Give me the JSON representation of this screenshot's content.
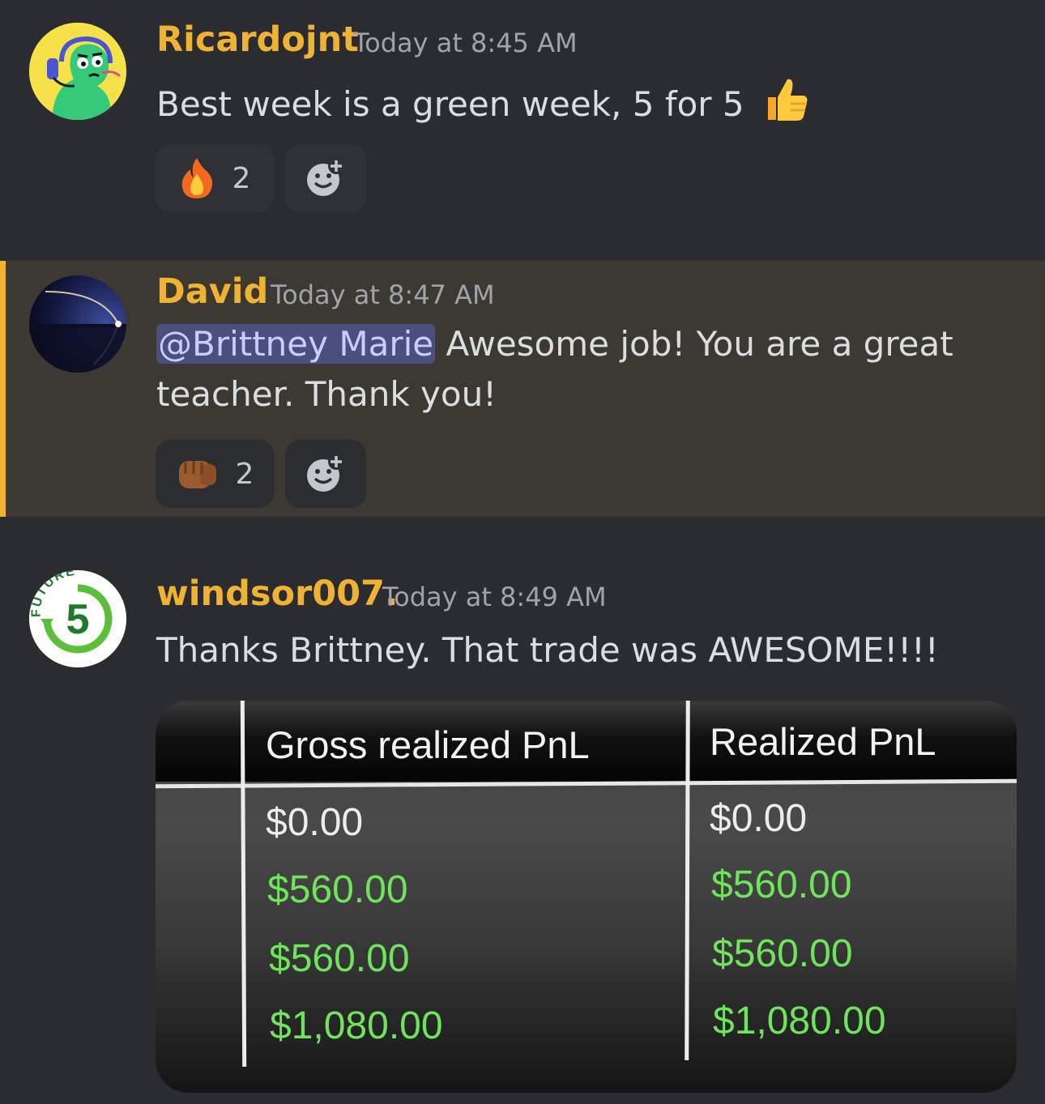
{
  "messages": [
    {
      "username": "Ricardojnt",
      "timestamp": "Today at 8:45 AM",
      "text": "Best week is a green week, 5 for 5",
      "text_emoji": "thumbs-up-icon",
      "reactions": [
        {
          "emoji": "fire-icon",
          "count": "2"
        },
        {
          "emoji": "add-reaction-icon"
        }
      ]
    },
    {
      "username": "David",
      "timestamp": "Today at 8:47 AM",
      "mention": "@Brittney Marie",
      "text_line1": " Awesome job! You are a great",
      "text_line2": "teacher. Thank you!",
      "reactions": [
        {
          "emoji": "fist-bump-icon",
          "count": "2"
        },
        {
          "emoji": "add-reaction-icon"
        }
      ]
    },
    {
      "username": "windsor007.",
      "timestamp": "Today at 8:49 AM",
      "text": "Thanks Brittney. That trade was AWESOME!!!!",
      "avatar_text": "FUTURE",
      "avatar_number": "5",
      "attachment": {
        "columns": [
          "Gross realized PnL",
          "Realized PnL"
        ],
        "rows": [
          [
            "$0.00",
            "$0.00"
          ],
          [
            "$560.00",
            "$560.00"
          ],
          [
            "$560.00",
            "$560.00"
          ],
          [
            "$1,080.00",
            "$1,080.00"
          ]
        ]
      }
    }
  ],
  "colors": {
    "background": "#2b2c31",
    "username": "#f0b232",
    "highlight_bar": "#f0b232",
    "mention_bg": "#4a4f7d",
    "positive_value": "#6ee45a"
  }
}
